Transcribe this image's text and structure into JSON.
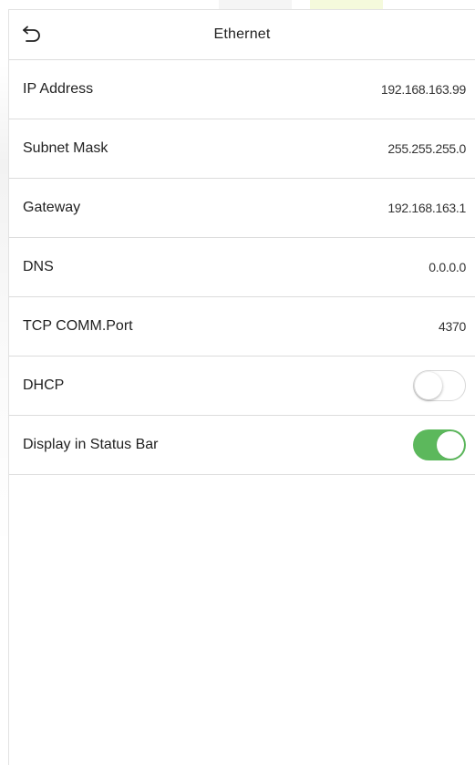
{
  "header": {
    "title": "Ethernet",
    "back_icon": "back-arrow-icon"
  },
  "rows": [
    {
      "label": "IP Address",
      "value": "192.168.163.99"
    },
    {
      "label": "Subnet Mask",
      "value": "255.255.255.0"
    },
    {
      "label": "Gateway",
      "value": "192.168.163.1"
    },
    {
      "label": "DNS",
      "value": "0.0.0.0"
    },
    {
      "label": "TCP COMM.Port",
      "value": "4370"
    }
  ],
  "toggles": [
    {
      "label": "DHCP",
      "state": "off"
    },
    {
      "label": "Display in Status Bar",
      "state": "on"
    }
  ],
  "colors": {
    "toggle_on": "#5cb85c",
    "divider": "#dcdcdc"
  }
}
